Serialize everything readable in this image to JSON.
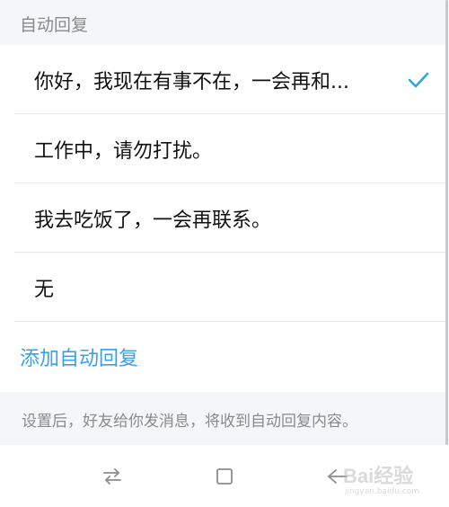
{
  "header": {
    "title": "自动回复"
  },
  "replies": [
    {
      "label": "你好，我现在有事不在，一会再和...",
      "selected": true
    },
    {
      "label": "工作中，请勿打扰。",
      "selected": false
    },
    {
      "label": "我去吃饭了，一会再联系。",
      "selected": false
    },
    {
      "label": "无",
      "selected": false
    }
  ],
  "add_reply": {
    "label": "添加自动回复"
  },
  "footer": {
    "note": "设置后，好友给你发消息，将收到自动回复内容。"
  },
  "colors": {
    "accent": "#3aa0e8",
    "check": "#29a8e8",
    "background": "#f5f6f8"
  },
  "icons": {
    "check": "check-icon",
    "recents": "recents-icon",
    "home": "home-icon",
    "back": "back-icon"
  },
  "watermark": {
    "brand": "Bai",
    "brand_suffix": "经验",
    "url": "jingyan.baidu.com"
  }
}
